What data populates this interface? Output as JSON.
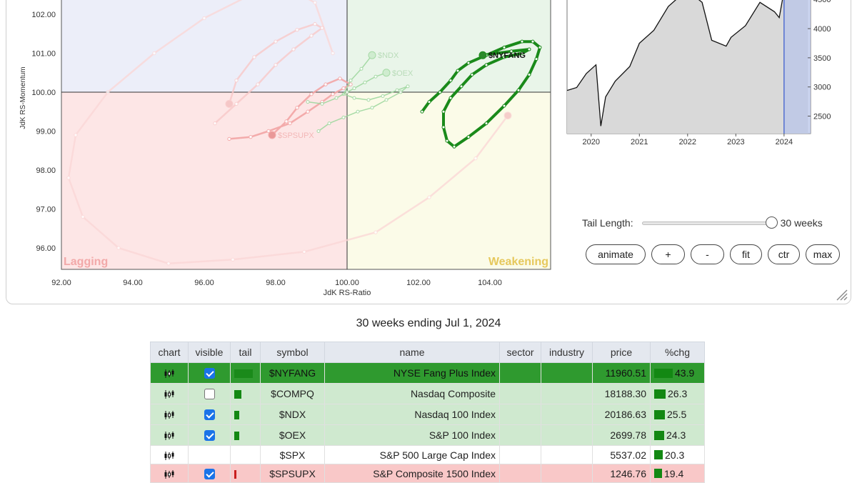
{
  "rrg": {
    "x_axis_label": "JdK RS-Ratio",
    "y_axis_label": "JdK RS-Momentum",
    "x_ticks": [
      "92.00",
      "94.00",
      "96.00",
      "98.00",
      "100.00",
      "102.00",
      "104.00"
    ],
    "y_ticks": [
      "102.00",
      "101.00",
      "100.00",
      "99.00",
      "98.00",
      "97.00",
      "96.00"
    ],
    "quadrant_lagging": "Lagging",
    "quadrant_weakening": "Weakening"
  },
  "mini_chart": {
    "y_ticks": [
      "4500",
      "4000",
      "3500",
      "3000",
      "2500"
    ],
    "x_ticks": [
      "2020",
      "2021",
      "2022",
      "2023",
      "2024"
    ]
  },
  "controls": {
    "tail_label": "Tail Length:",
    "tail_value": "30 weeks",
    "tail_fraction": 1.0,
    "buttons": [
      {
        "id": "animate",
        "label": "animate"
      },
      {
        "id": "plus",
        "label": "+"
      },
      {
        "id": "minus",
        "label": "-"
      },
      {
        "id": "fit",
        "label": "fit"
      },
      {
        "id": "ctr",
        "label": "ctr"
      },
      {
        "id": "max",
        "label": "max"
      }
    ]
  },
  "caption": "30 weeks ending Jul 1, 2024",
  "table": {
    "headers": [
      "chart",
      "visible",
      "tail",
      "symbol",
      "name",
      "sector",
      "industry",
      "price",
      "%chg"
    ],
    "rows": [
      {
        "symbol": "$NYFANG",
        "name": "NYSE Fang Plus Index",
        "sector": "",
        "industry": "",
        "price": "11960.51",
        "chg": "43.9",
        "visible": "checked",
        "tail_color": "#1a8a1a",
        "style": "bright"
      },
      {
        "symbol": "$COMPQ",
        "name": "Nasdaq Composite",
        "sector": "",
        "industry": "",
        "price": "18188.30",
        "chg": "26.3",
        "visible": "unchecked",
        "tail_color": "#138813",
        "style": "green"
      },
      {
        "symbol": "$NDX",
        "name": "Nasdaq 100 Index",
        "sector": "",
        "industry": "",
        "price": "20186.63",
        "chg": "25.5",
        "visible": "checked",
        "tail_color": "#138813",
        "style": "green"
      },
      {
        "symbol": "$OEX",
        "name": "S&P 100 Index",
        "sector": "",
        "industry": "",
        "price": "2699.78",
        "chg": "24.3",
        "visible": "checked",
        "tail_color": "#138813",
        "style": "green"
      },
      {
        "symbol": "$SPX",
        "name": "S&P 500 Large Cap Index",
        "sector": "",
        "industry": "",
        "price": "5537.02",
        "chg": "20.3",
        "visible": "none",
        "tail_color": "",
        "style": "white"
      },
      {
        "symbol": "$SPSUPX",
        "name": "S&P Composite 1500 Index",
        "sector": "",
        "industry": "",
        "price": "1246.76",
        "chg": "19.4",
        "visible": "checked",
        "tail_color": "#c81e1e",
        "style": "red"
      }
    ]
  },
  "chart_data": [
    {
      "type": "scatter",
      "title": "",
      "xlabel": "JdK RS-Ratio",
      "ylabel": "JdK RS-Momentum",
      "xlim": [
        92,
        105.7
      ],
      "ylim": [
        95.4,
        102.3
      ],
      "quadrants": [
        "Lagging",
        "Weakening"
      ],
      "series": [
        {
          "name": "$NYFANG",
          "color": "#1a8a1a",
          "x": [
            102.1,
            102.3,
            102.6,
            102.9,
            103.1,
            103.4,
            103.9,
            104.4,
            104.9,
            105.2,
            105.4,
            105.3,
            105.1,
            104.8,
            104.4,
            103.9,
            103.4,
            103.0,
            102.8,
            102.7,
            102.7,
            102.9,
            103.2,
            103.5,
            103.9,
            104.4,
            104.9,
            105.1,
            104.6,
            103.8
          ],
          "y": [
            99.5,
            99.75,
            100.0,
            100.3,
            100.55,
            100.75,
            100.95,
            101.15,
            101.3,
            101.3,
            101.15,
            100.85,
            100.45,
            100.05,
            99.65,
            99.2,
            98.85,
            98.6,
            98.75,
            99.1,
            99.5,
            99.85,
            100.15,
            100.45,
            100.7,
            100.9,
            101.0,
            101.1,
            101.05,
            100.95
          ]
        },
        {
          "name": "$NDX",
          "color": "#9fd89f",
          "x": [
            99.2,
            99.5,
            99.9,
            100.3,
            100.7,
            101.1,
            101.5,
            101.7,
            101.4,
            101.0,
            100.6,
            100.2,
            99.9,
            100.1,
            100.4,
            100.7
          ],
          "y": [
            99.0,
            99.2,
            99.35,
            99.5,
            99.6,
            99.8,
            100.0,
            100.15,
            100.05,
            99.9,
            99.8,
            99.85,
            99.95,
            100.3,
            100.6,
            100.95
          ]
        },
        {
          "name": "$OEX",
          "color": "#9fd89f",
          "x": [
            98.9,
            99.3,
            99.7,
            100.0,
            100.2,
            100.5,
            100.8,
            101.1
          ],
          "y": [
            99.75,
            99.7,
            99.85,
            100.0,
            100.1,
            100.25,
            100.4,
            100.5
          ]
        },
        {
          "name": "$SPSUPX",
          "color": "#f3a5a5",
          "x": [
            96.7,
            97.3,
            97.8,
            98.4,
            98.9,
            99.3,
            99.6,
            99.9,
            100.1,
            99.8,
            99.4,
            99.0,
            98.6,
            98.3,
            97.9
          ],
          "y": [
            98.8,
            98.85,
            99.0,
            99.2,
            99.5,
            99.75,
            99.95,
            100.1,
            100.2,
            100.35,
            100.2,
            99.95,
            99.6,
            99.25,
            98.9
          ]
        },
        {
          "name": "$SPX",
          "color": "#f9c9c9",
          "x": [
            96.3,
            96.9,
            97.5,
            98.0,
            98.5,
            99.0,
            99.3,
            99.1,
            98.6,
            98.0,
            97.4,
            96.9,
            96.7
          ],
          "y": [
            99.2,
            99.7,
            100.2,
            100.7,
            101.1,
            101.45,
            101.65,
            101.75,
            101.6,
            101.3,
            100.9,
            100.3,
            99.7
          ]
        },
        {
          "name": "$COMPQ",
          "color": "#fbd6d6",
          "x": [
            99.6,
            99.1,
            98.3,
            97.3,
            96.0,
            94.6,
            93.3,
            92.4,
            92.2,
            92.6,
            93.6,
            95.0,
            96.8,
            98.8,
            100.8,
            102.3,
            103.6,
            104.5
          ],
          "y": [
            101.0,
            102.3,
            102.7,
            102.5,
            101.9,
            101.0,
            100.0,
            98.9,
            97.8,
            96.8,
            96.0,
            95.6,
            95.7,
            95.9,
            96.4,
            97.3,
            98.3,
            99.4
          ]
        }
      ]
    },
    {
      "type": "area",
      "x": [
        2019.5,
        2019.7,
        2019.9,
        2020.1,
        2020.2,
        2020.3,
        2020.5,
        2020.8,
        2021.0,
        2021.3,
        2021.6,
        2021.9,
        2022.0,
        2022.3,
        2022.5,
        2022.8,
        2022.9,
        2023.2,
        2023.5,
        2023.8,
        2023.9,
        2024.0,
        2024.2,
        2024.5
      ],
      "y": [
        2940,
        2990,
        3230,
        3380,
        2330,
        2830,
        3100,
        3350,
        3750,
        3970,
        4380,
        4600,
        4790,
        4450,
        3800,
        3700,
        3850,
        4050,
        4450,
        4290,
        4190,
        4650,
        5100,
        5480
      ],
      "ylim": [
        2200,
        4650
      ],
      "xlim": [
        2019.5,
        2024.55
      ],
      "highlight_from": 2024.0
    }
  ]
}
